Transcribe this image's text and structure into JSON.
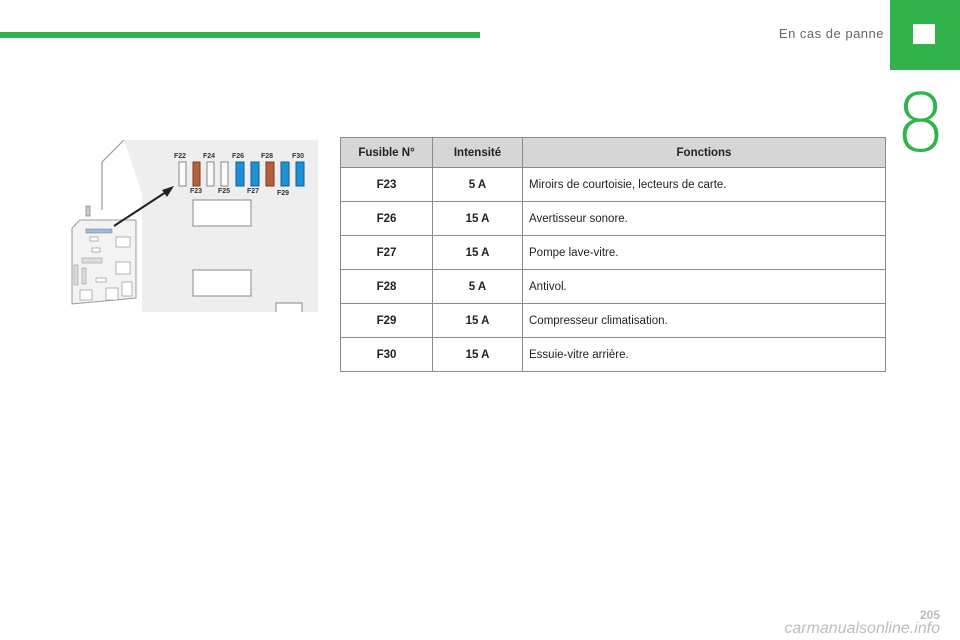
{
  "header": {
    "section_title": "En cas de panne",
    "chapter_number": "8"
  },
  "diagram": {
    "fuse_top_labels": [
      "F22",
      "F24",
      "F26",
      "F28",
      "F30"
    ],
    "fuse_bottom_labels": [
      "F23",
      "F25",
      "F27",
      "F29"
    ]
  },
  "table": {
    "headers": [
      "Fusible N°",
      "Intensité",
      "Fonctions"
    ],
    "rows": [
      {
        "fuse": "F23",
        "amp": "5 A",
        "func": "Miroirs de courtoisie, lecteurs de carte."
      },
      {
        "fuse": "F26",
        "amp": "15 A",
        "func": "Avertisseur sonore."
      },
      {
        "fuse": "F27",
        "amp": "15 A",
        "func": "Pompe lave-vitre."
      },
      {
        "fuse": "F28",
        "amp": "5 A",
        "func": "Antivol."
      },
      {
        "fuse": "F29",
        "amp": "15 A",
        "func": "Compresseur climatisation."
      },
      {
        "fuse": "F30",
        "amp": "15 A",
        "func": "Essuie-vitre arrière."
      }
    ]
  },
  "footer": {
    "page_number": "205",
    "watermark": "carmanualsonline.info"
  },
  "colors": {
    "accent_green": "#2fb34a",
    "fuse_blue": "#1e90d6",
    "fuse_brown": "#b5603c"
  }
}
